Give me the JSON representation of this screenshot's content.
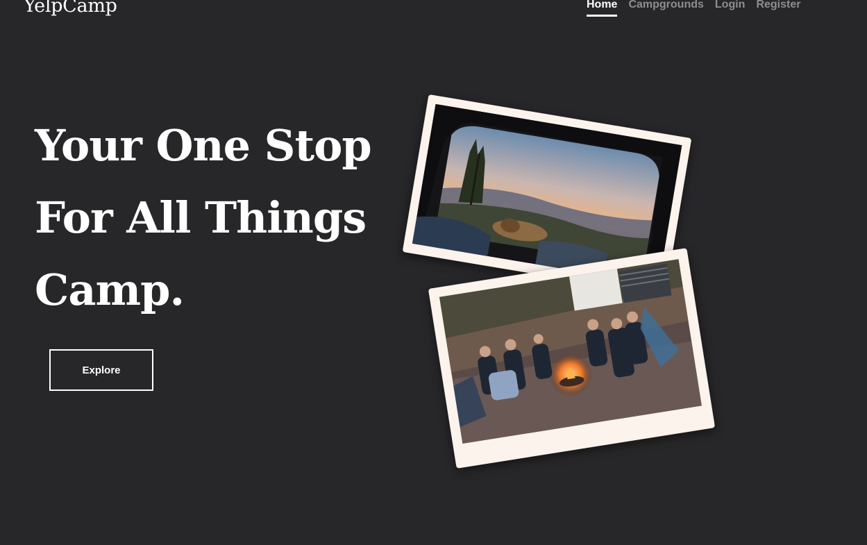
{
  "brand": {
    "name": "YelpCamp"
  },
  "nav": {
    "items": [
      {
        "label": "Home"
      },
      {
        "label": "Campgrounds"
      },
      {
        "label": "Login"
      },
      {
        "label": "Register"
      }
    ]
  },
  "hero": {
    "lines": [
      "Your One Stop",
      "For All Things",
      "Camp."
    ],
    "explore_label": "Explore"
  },
  "colors": {
    "background": "#272729",
    "text": "#ffffff",
    "nav_muted": "#8e8e92",
    "photo_frame": "#fbf3ec"
  },
  "photos": [
    {
      "name": "car-camping-sunset-photo"
    },
    {
      "name": "campfire-group-photo"
    }
  ]
}
